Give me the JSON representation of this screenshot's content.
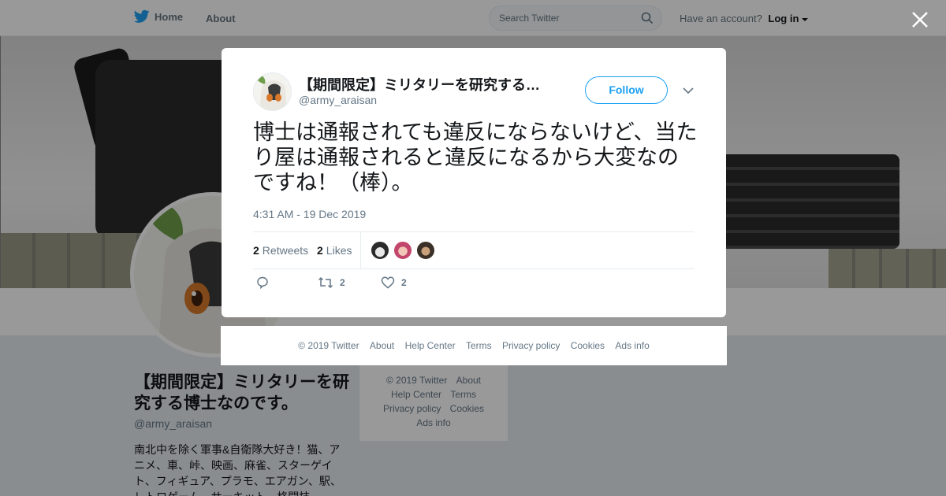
{
  "nav": {
    "home_label": "Home",
    "about_label": "About",
    "search_placeholder": "Search Twitter",
    "have_account": "Have an account?",
    "login_label": "Log in"
  },
  "profile": {
    "name": "【期間限定】ミリタリーを研究する博士なのです。",
    "handle": "@army_araisan",
    "bio": "南北中を除く軍事&自衛隊大好き！猫、アニメ、車、峠、映画、麻雀、スターゲイト、フィギュア、プラモ、エアガン、駅、レトロゲーム、サーキット、格闘技"
  },
  "side_footer": {
    "copyright": "© 2019 Twitter",
    "about": "About",
    "help": "Help Center",
    "terms": "Terms",
    "privacy": "Privacy policy",
    "cookies": "Cookies",
    "ads": "Ads info"
  },
  "tweet": {
    "display_name": "【期間限定】ミリタリーを研究する…",
    "handle": "@army_araisan",
    "follow_label": "Follow",
    "text": "博士は通報されても違反にならないけど、当たり屋は通報されると違反になるから大変なのですね！（棒）。",
    "timestamp": "4:31 AM - 19 Dec 2019",
    "retweets_count": "2",
    "retweets_label": "Retweets",
    "likes_count": "2",
    "likes_label": "Likes",
    "action_retweet_count": "2",
    "action_like_count": "2"
  },
  "modal_footer": {
    "copyright": "© 2019 Twitter",
    "about": "About",
    "help": "Help Center",
    "terms": "Terms",
    "privacy": "Privacy policy",
    "cookies": "Cookies",
    "ads": "Ads info"
  },
  "colors": {
    "brand": "#1da1f2",
    "text_secondary": "#657786"
  }
}
